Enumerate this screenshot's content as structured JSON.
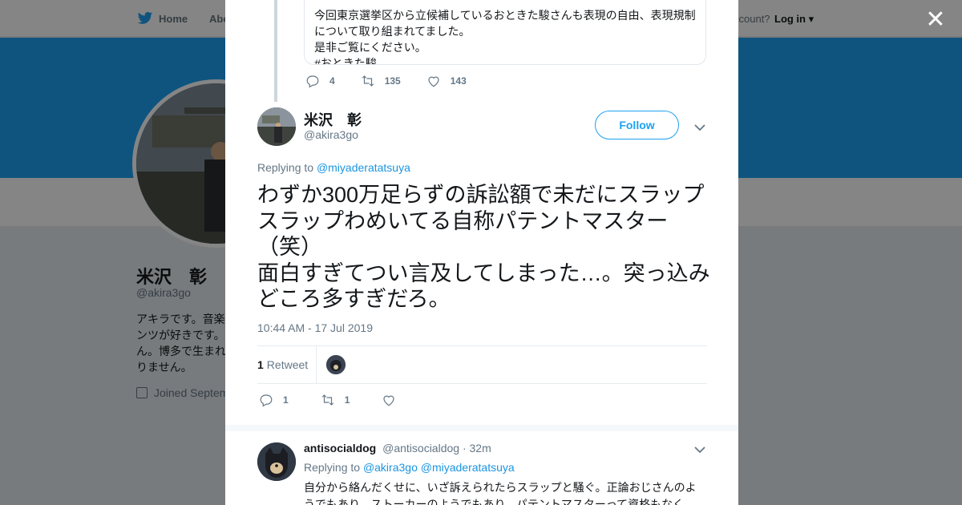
{
  "nav": {
    "home_label": "Home",
    "about_label": "Abo",
    "account_prompt": "ccount?",
    "login_label": "Log in"
  },
  "profile": {
    "name": "米沢　彰",
    "handle": "@akira3go",
    "bio": "アキラです。音楽\nンツが好きです。\nん。博多で生まれ\nりません。",
    "joined": "Joined Septem"
  },
  "colors": {
    "brand": "#1da1f2",
    "link": "#1b95e0",
    "text_secondary": "#657786"
  },
  "quoted_tweet": {
    "text": "今回東京選挙区から立候補しているおときた駿さんも表現の自由、表現規制\nについて取り組まれてました。\n是非ご覧にください。\n#おときた駿…",
    "replies": "4",
    "retweets": "135",
    "likes": "143"
  },
  "tweet": {
    "author_name": "米沢　彰",
    "author_handle": "@akira3go",
    "follow_label": "Follow",
    "replying_prefix": "Replying to",
    "replying_to": "@miyaderatatsuya",
    "text": "わずか300万足らずの訴訟額で未だにスラップスラップわめいてる自称パテントマスター（笑）\n面白すぎてつい言及してしまった…。突っ込みどころ多すぎだろ。",
    "timestamp": "10:44 AM - 17 Jul 2019",
    "retweet_count": "1",
    "retweet_label": "Retweet",
    "replies": "1",
    "retweets": "1"
  },
  "reply": {
    "author_name": "antisocialdog",
    "author_handle": "@antisocialdog",
    "time": "· 32m",
    "replying_prefix": "Replying to",
    "replying_to_1": "@akira3go",
    "replying_to_2": "@miyaderatatsuya",
    "text": "自分から絡んだくせに、いざ訴えられたらスラップと騒ぐ。正論おじさんのよ\nうでもあり、ストーカーのようでもあり、パテントマスターって資格もなく"
  },
  "icons": {
    "twitter": "twitter-bird-icon",
    "close": "close-icon",
    "reply": "reply-icon",
    "retweet": "retweet-icon",
    "like": "heart-icon",
    "chevron": "chevron-down-icon",
    "calendar": "calendar-icon"
  }
}
